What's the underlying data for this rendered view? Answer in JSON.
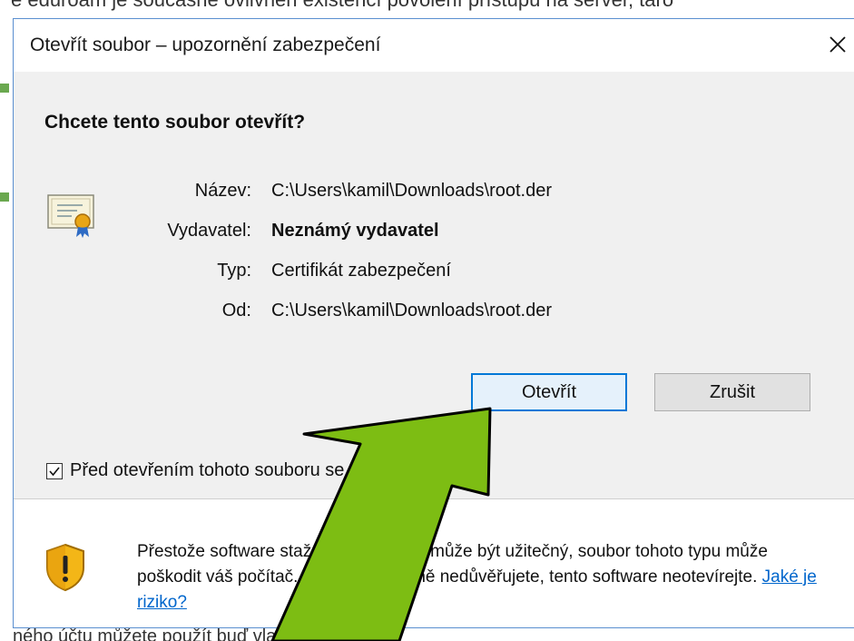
{
  "background": {
    "top_text": "e eduroam je současně ovlivněn existencí povolení přístupu na server, taro",
    "bottom_text": "ného účtu můžete použít buď vlastní certifikát"
  },
  "dialog": {
    "title": "Otevřít soubor – upozornění zabezpečení",
    "close_glyph": "✕",
    "question": "Chcete tento soubor otevřít?",
    "fields": [
      {
        "label": "Název:",
        "value": "C:\\Users\\kamil\\Downloads\\root.der",
        "bold": false
      },
      {
        "label": "Vydavatel:",
        "value": "Neznámý vydavatel",
        "bold": true
      },
      {
        "label": "Typ:",
        "value": "Certifikát zabezpečení",
        "bold": false
      },
      {
        "label": "Od:",
        "value": "C:\\Users\\kamil\\Downloads\\root.der",
        "bold": false
      }
    ],
    "open_button": "Otevřít",
    "cancel_button": "Zrušit",
    "checkbox_label": "Před otevřením tohoto souboru se vždy dotázat",
    "checkbox_checked": true,
    "warning_text": "Přestože software stažený z Internetu může být užitečný, soubor tohoto typu může poškodit váš počítač. Pokud zdroji plně nedůvěřujete, tento software neotevírejte.",
    "warning_link": "Jaké je riziko?"
  },
  "annotation": {
    "arrow_color": "#7dbd13",
    "arrow_outline": "#000000"
  }
}
